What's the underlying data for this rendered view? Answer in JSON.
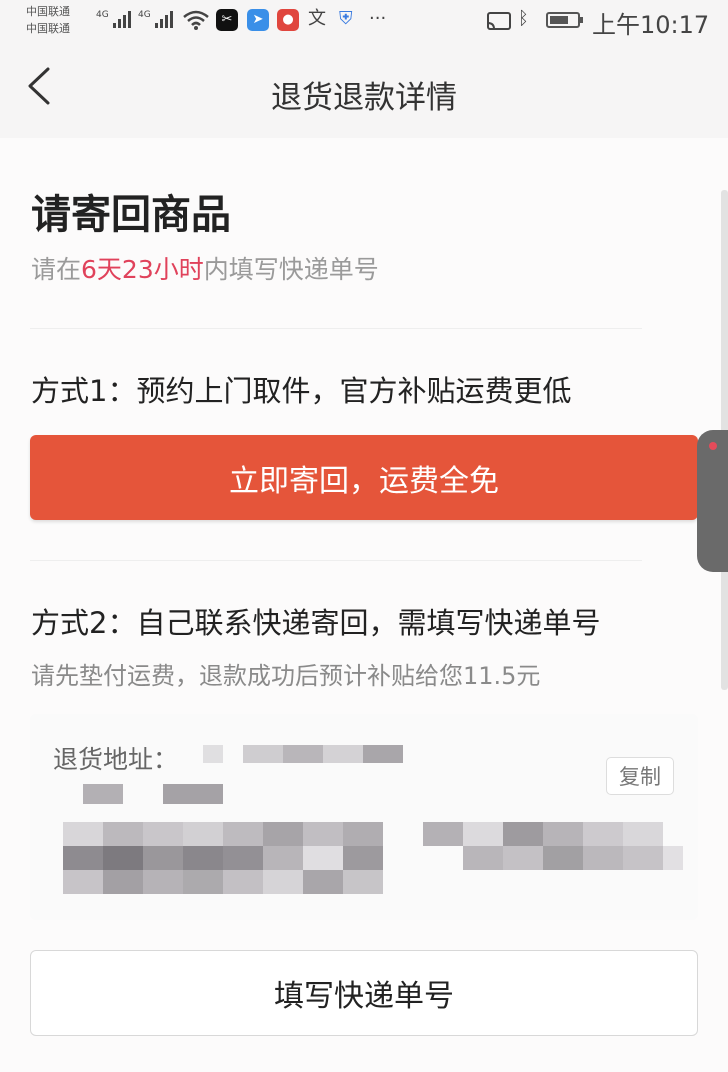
{
  "status_bar": {
    "carrier_1": "中国联通",
    "carrier_2": "中国联通",
    "network_1": "4G",
    "network_2": "4G",
    "time": "上午10:17",
    "apps": [
      "wifi-icon",
      "capcut-icon",
      "browser-icon",
      "mic-icon",
      "text-icon",
      "shield-icon",
      "more-icon"
    ],
    "right_icons": [
      "screencast-icon",
      "bluetooth-icon",
      "battery-icon"
    ]
  },
  "nav": {
    "title": "退货退款详情",
    "back_icon": "chevron-left-icon"
  },
  "content": {
    "heading": "请寄回商品",
    "deadline_prefix": "请在",
    "deadline_highlight": "6天23小时",
    "deadline_suffix": "内填写快递单号",
    "method1": "方式1：预约上门取件，官方补贴运费更低",
    "method1_button": "立即寄回，运费全免",
    "method2": "方式2：自己联系快递寄回，需填写快递单号",
    "method2_note": "请先垫付运费，退款成功后预计补贴给您11.5元",
    "address_label": "退货地址：",
    "copy_button": "复制",
    "fill_button": "填写快递单号"
  },
  "colors": {
    "accent": "#e5553a",
    "highlight": "#e0425b"
  }
}
